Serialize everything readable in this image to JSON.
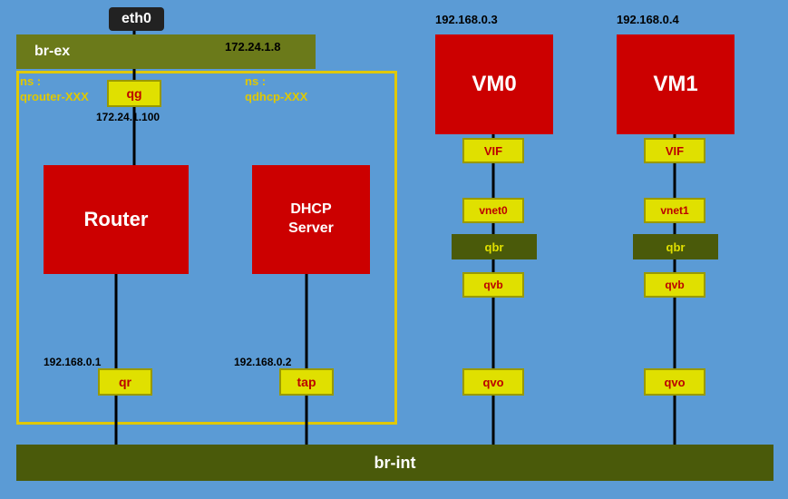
{
  "eth0": {
    "label": "eth0"
  },
  "br_ex": {
    "label": "br-ex",
    "ip": "172.24.1.8"
  },
  "ns_left": {
    "label": "ns :\nqrouter-XXX"
  },
  "ns_right": {
    "label": "ns :\nqdhcp-XXX"
  },
  "qg": {
    "label": "qg",
    "ip": "172.24.1.100"
  },
  "router": {
    "label": "Router"
  },
  "dhcp": {
    "label": "DHCP\nServer"
  },
  "qr": {
    "label": "qr",
    "ip": "192.168.0.1"
  },
  "tap": {
    "label": "tap",
    "ip": "192.168.0.2"
  },
  "br_int": {
    "label": "br-int"
  },
  "vm0": {
    "label": "VM0",
    "ip": "192.168.0.3"
  },
  "vm1": {
    "label": "VM1",
    "ip": "192.168.0.4"
  },
  "vif0": {
    "label": "VIF"
  },
  "vif1": {
    "label": "VIF"
  },
  "vnet0": {
    "label": "vnet0"
  },
  "vnet1": {
    "label": "vnet1"
  },
  "qbr0": {
    "label": "qbr"
  },
  "qbr1": {
    "label": "qbr"
  },
  "qvb0": {
    "label": "qvb"
  },
  "qvb1": {
    "label": "qvb"
  },
  "qvo0": {
    "label": "qvo"
  },
  "qvo1": {
    "label": "qvo"
  }
}
